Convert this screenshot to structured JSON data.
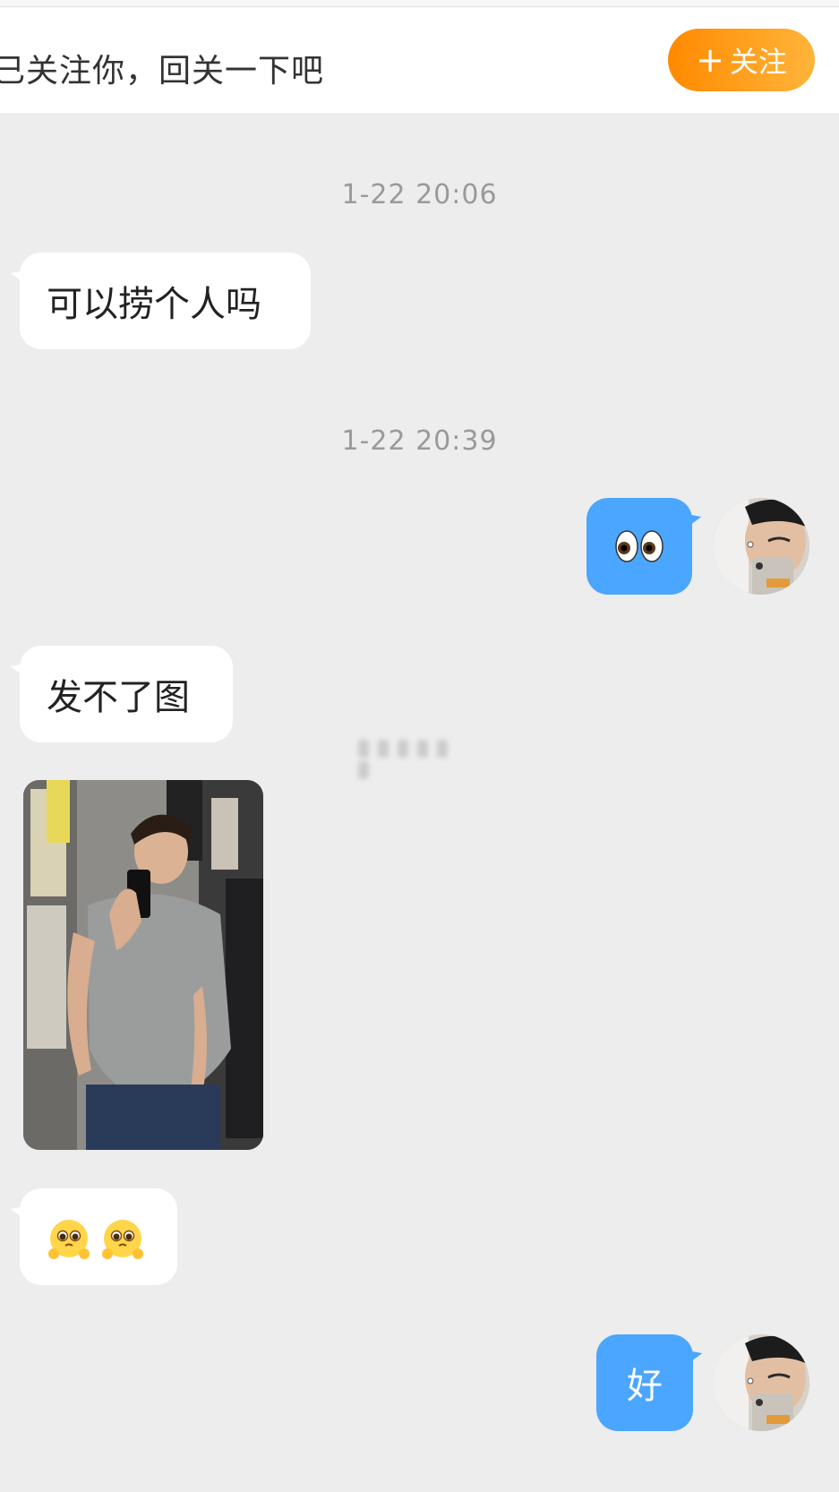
{
  "follow_bar": {
    "text": "已关注你，回关一下吧",
    "button_plus": "+",
    "button_label": "关注"
  },
  "messages": [
    {
      "type": "timestamp",
      "text": "1-22 20:06"
    },
    {
      "type": "incoming",
      "text": "可以捞个人吗"
    },
    {
      "type": "timestamp",
      "text": "1-22 20:39"
    },
    {
      "type": "outgoing",
      "emoji": "eyes-emoji"
    },
    {
      "type": "incoming",
      "text": "发不了图"
    },
    {
      "type": "incoming-image",
      "image": "mirror-selfie-photo"
    },
    {
      "type": "incoming",
      "emoji": "pleading-face-emoji-x2"
    },
    {
      "type": "outgoing",
      "text": "好"
    }
  ],
  "colors": {
    "background": "#ededed",
    "bubble_incoming": "#ffffff",
    "bubble_outgoing": "#4aa6ff",
    "follow_button": "#ff8a00",
    "timestamp": "#9a9a9a"
  }
}
